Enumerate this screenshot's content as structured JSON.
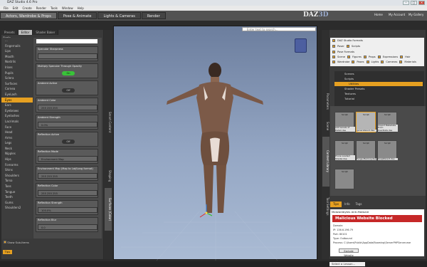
{
  "window": {
    "title": "DAZ Studio 4.6 Pro"
  },
  "menu": [
    "File",
    "Edit",
    "Create",
    "Render",
    "Tools",
    "Window",
    "Help"
  ],
  "brand": {
    "logo_left": "DAZ",
    "logo_right": "3D",
    "top_links": [
      "Home",
      "My Account",
      "My Gallery"
    ]
  },
  "rooms": [
    "Actors, Wardrobe & Props",
    "Pose & Animate",
    "Lights & Cameras",
    "Render"
  ],
  "left_panel": {
    "tabs": [
      "Presets",
      "Editor",
      "Shader Baker"
    ],
    "surface_label": "Shells",
    "nodes": [
      "...",
      "Fingernails",
      "Lips",
      "Mouth",
      "Nostrils",
      "Irises",
      "Pupils",
      "Sclera",
      "Surfaces",
      "Cornea",
      "EyeLash",
      "Eyes",
      "Ears",
      "Eyebrows",
      "Eyelashes",
      "Lacrimals",
      "Face",
      "Head",
      "Arms",
      "Legs",
      "Neck",
      "Nipples",
      "Hips",
      "Forearms",
      "Shins",
      "Shoulders",
      "Torso",
      "Toes",
      "Tongue",
      "Teeth",
      "Gums",
      "Shoulders2"
    ],
    "nodes_selected": "Eyes",
    "props": [
      {
        "label": "Specular Sharpness",
        "value": ""
      },
      {
        "label": "Multiply Specular Through Opacity",
        "value": "On"
      },
      {
        "label": "Ambient Active",
        "value": "Off"
      },
      {
        "label": "Ambient Color",
        "value": "255   255   255"
      },
      {
        "label": "Ambient Strength",
        "value": "0.0%"
      },
      {
        "label": "Reflection Active",
        "value": "Off"
      },
      {
        "label": "Reflection Mode",
        "value": "Environment Map"
      },
      {
        "label": "Environment Map (Map to Lat/Long format)",
        "value": "255   255   255"
      },
      {
        "label": "Reflection Color",
        "value": "255   255   255"
      },
      {
        "label": "Reflection Strength",
        "value": "100.0%"
      },
      {
        "label": "Reflection Blur",
        "value": "0.0"
      }
    ],
    "bottom_label": "Show Sub-Items",
    "tips": "Tips"
  },
  "side_tabs_left": [
    "Smart Content",
    "Shaping",
    "Surfaces (Color)"
  ],
  "viewport": {
    "search_placeholder": "Enter text to search...",
    "camera": "Perspective View"
  },
  "right_panel": {
    "side_tabs": [
      "Parameters",
      "Content Library",
      "Scene",
      "Tool Settings"
    ],
    "search": "",
    "filter_title": "DAZ Studio Formats",
    "filter_rows": [
      [
        "Poser",
        "Scripts"
      ],
      [
        "Pose Formats"
      ],
      [
        "Scene",
        "Figures",
        "Props",
        "Expressions",
        "Hair"
      ],
      [
        "Wardrobe",
        "Poses",
        "Lights",
        "Cameras",
        "Materials"
      ]
    ],
    "tree": [
      "Scenes",
      "Scripts",
      "Utilities",
      "Shader Presets",
      "Textures",
      "Tutorial"
    ],
    "tree_selected": "Utilities",
    "thumbs": [
      {
        "tag": "Script",
        "caption": "Add Levels of Detail.dse"
      },
      {
        "tag": "Script",
        "caption": "generateLod.dse"
      },
      {
        "tag": "Script",
        "caption": "Import Metadata From UserData.dse"
      },
      {
        "tag": "Script",
        "caption": "Prune Loaded Shader.dse"
      },
      {
        "tag": "Script",
        "caption": "Purge Memory.dse"
      },
      {
        "tag": "Script",
        "caption": "SnapParent.dse"
      },
      {
        "tag": "Script",
        "caption": ""
      }
    ],
    "tabs": [
      "Tips",
      "Info",
      "Tags"
    ],
    "malware": {
      "app": "Malwarebytes Anti-Malware",
      "title": "Malicious Website Blocked",
      "rows": [
        "Domain:",
        "IP:      136.6.196.79",
        "Port:     80101",
        "Type:     Outbound",
        "Process: C:\\Users\\Public\\AppData\\Roaming\\ServerPHPServer.exe"
      ],
      "button": "Exclude Website"
    }
  },
  "taskbar": {
    "lesson": "Select a Lesson..."
  }
}
